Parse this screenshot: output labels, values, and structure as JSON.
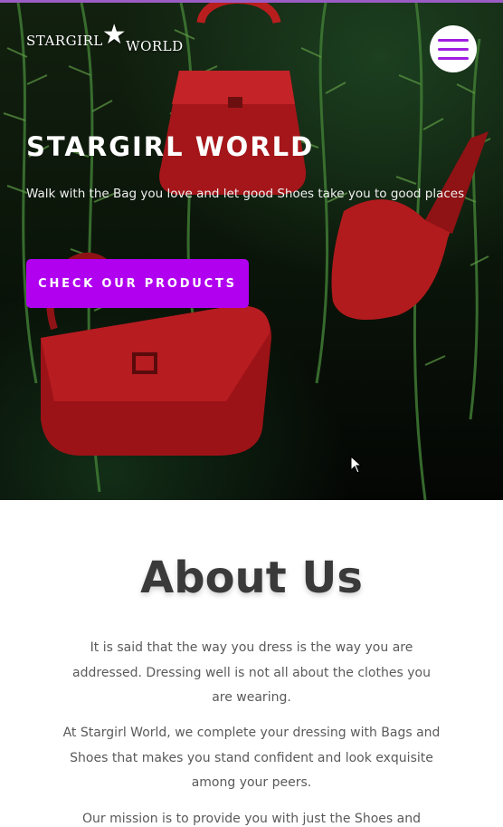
{
  "header": {
    "brand_left": "STARGIRL",
    "brand_right": "WORLD",
    "brand_star": "★",
    "menu_icon": "hamburger-icon"
  },
  "hero": {
    "title": "STARGIRL WORLD",
    "tagline": "Walk with the Bag you love and let good Shoes take you to good places",
    "cta_label": "CHECK OUR PRODUCTS"
  },
  "about": {
    "title": "About Us",
    "paragraph_1": "It is said that the way you dress is the way you are addressed. Dressing well is not all about the clothes you are wearing.",
    "paragraph_2": "At Stargirl World, we complete your dressing with Bags and Shoes that makes you stand confident and look exquisite among your peers.",
    "paragraph_3": "Our mission is to provide you with just the Shoes and"
  },
  "colors": {
    "accent": "#b100f0",
    "menu_lines": "#a01de0",
    "about_heading": "#3a3a3a",
    "body_text": "#5a5a5a"
  }
}
